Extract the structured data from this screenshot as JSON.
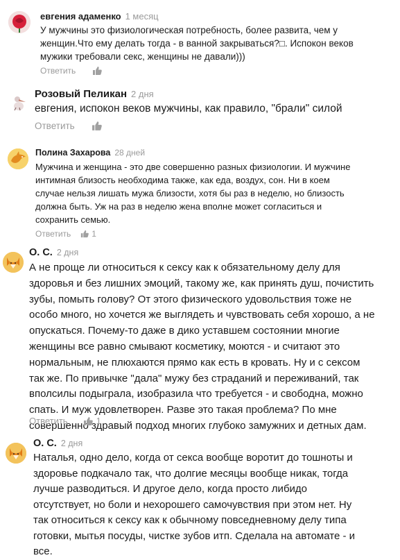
{
  "comments": [
    {
      "author": "евгения адаменко",
      "time": "1 месяц",
      "text": "У мужчины это физиологическая потребность, более развита, чем у женщин.Что ему делать тогда - в ванной закрываться?□. Испокон веков мужики требовали секс, женщины не давали)))",
      "reply_label": "Ответить",
      "likes": ""
    },
    {
      "author": "Розовый Пеликан",
      "time": "2 дня",
      "text": "евгения, испокон веков мужчины, как правило, \"брали\" силой",
      "reply_label": "Ответить",
      "likes": ""
    },
    {
      "author": "Полина Захарова",
      "time": "28 дней",
      "text": "Мужчина и женщина - это две совершенно разных физиологии. И мужчине интимная близость необходима также, как еда, воздух, сон. Ни в коем случае нельзя лишать мужа близости, хотя бы раз в неделю, но близость должна быть. Уж на раз в неделю жена вполне может согласиться и сохранить семью.",
      "reply_label": "Ответить",
      "likes": "1"
    },
    {
      "author": "О. С.",
      "time": "2 дня",
      "text": "А не проще ли относиться к сексу как к обязательному делу для здоровья и без лишних эмоций, такому же, как принять душ, почистить зубы, помыть голову? От этого физического удовольствия тоже не особо много, но хочется же выглядеть и чувствовать себя хорошо, а не опускаться. Почему-то даже в дико уставшем состоянии многие женщины все равно смывают косметику, моются - и считают это нормальным, не плюхаются прямо как есть в кровать. Ну и с сексом так же. По привычке \"дала\" мужу без страданий и переживаний, так вполсилы подыграла, изобразила что требуется - и свободна, можно спать. И муж удовлетворен. Разве это такая проблема? По мне совершенно здравый подход многих глубоко замужних и детных дам.",
      "reply_label": "Ответить",
      "likes": "1"
    },
    {
      "author": "О. С.",
      "time": "2 дня",
      "text": "Наталья, одно дело, когда от секса вообще воротит до тошноты и здоровье подкачало так, что долгие месяцы вообще никак, тогда лучше разводиться. И другое дело, когда просто либидо отсутствует, но боли и нехорошего самочувствия при этом нет. Ну так относиться к сексу как к обычному повседневному делу типа готовки, мытья посуды, чистке зубов итп. Сделала на автомате - и все."
    }
  ],
  "colors": {
    "author": "#1b1b1b",
    "meta": "#9a9a9a",
    "text": "#1b1b1b"
  }
}
